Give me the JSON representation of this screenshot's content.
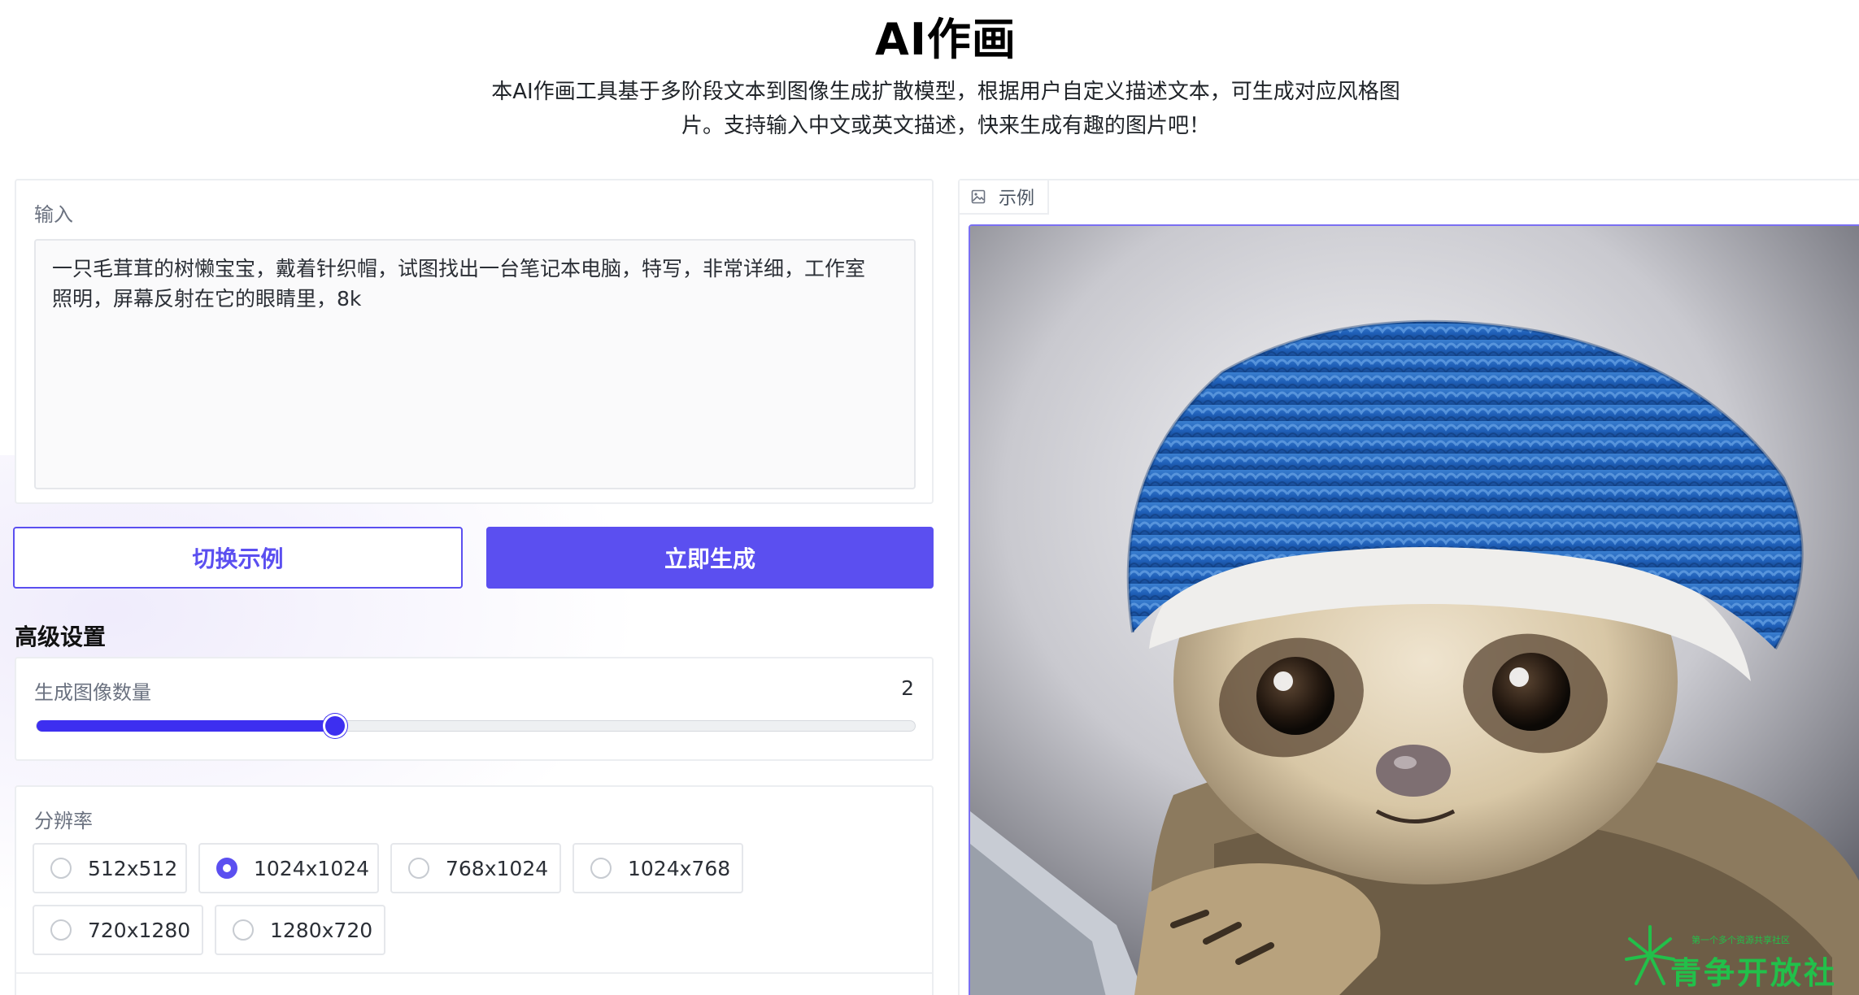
{
  "header": {
    "title": "AI作画",
    "description_line1": "本AI作画工具基于多阶段文本到图像生成扩散模型，根据用户自定义描述文本，可生成对应风格图",
    "description_line2": "片。支持输入中文或英文描述，快来生成有趣的图片吧！"
  },
  "input": {
    "label": "输入",
    "prompt_line1": "一只毛茸茸的树懒宝宝，戴着针织帽，试图找出一台笔记本电脑，特写，非常详细，工作室",
    "prompt_line2": "照明，屏幕反射在它的眼睛里，8k"
  },
  "buttons": {
    "switch_example": "切换示例",
    "generate": "立即生成"
  },
  "advanced": {
    "title": "高级设置",
    "image_count": {
      "label": "生成图像数量",
      "value": "2",
      "slider_fraction": 0.34
    },
    "resolution": {
      "label": "分辨率",
      "options": [
        "512x512",
        "1024x1024",
        "768x1024",
        "1024x768",
        "720x1280",
        "1280x720"
      ],
      "selected": "1024x1024"
    }
  },
  "output": {
    "tab_label": "示例",
    "image_subject": "sloth-in-blue-knit-hat"
  },
  "watermark": {
    "brand": "青争开放社区",
    "tagline": "第一个多个资源共享社区"
  },
  "colors": {
    "accent": "#5b4ff0",
    "slider": "#3d2ff0",
    "watermark": "#22c04a"
  }
}
